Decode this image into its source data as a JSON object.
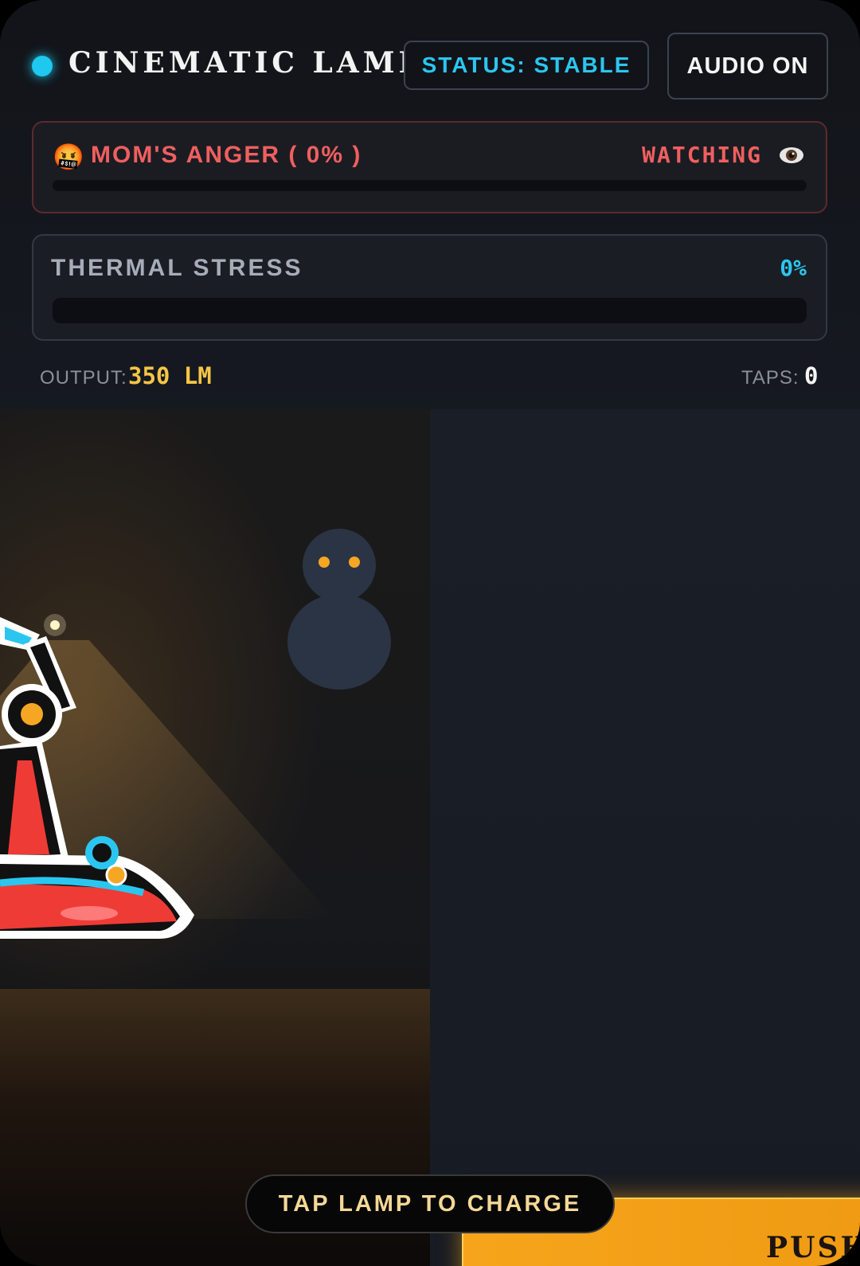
{
  "header": {
    "title": "CINEMATIC LAMP",
    "status": "STATUS: STABLE",
    "audio": "AUDIO ON"
  },
  "anger": {
    "emoji": "🤬",
    "label": "MOM'S ANGER ( 0% )",
    "value": 0,
    "watching": "WATCHING",
    "icon": "eye-icon"
  },
  "thermal": {
    "label": "THERMAL STRESS",
    "value_text": "0%",
    "value": 0
  },
  "stats": {
    "output_label": "OUTPUT:",
    "output_value": "350 LM",
    "taps_label": "TAPS:",
    "taps_value": "0"
  },
  "stage": {
    "push_label": "PUSH",
    "hint": "TAP LAMP TO CHARGE"
  },
  "colors": {
    "accent": "#1ec8ee",
    "anger": "#ef5f5f",
    "output": "#f5c546",
    "button": "#f6a51b"
  }
}
